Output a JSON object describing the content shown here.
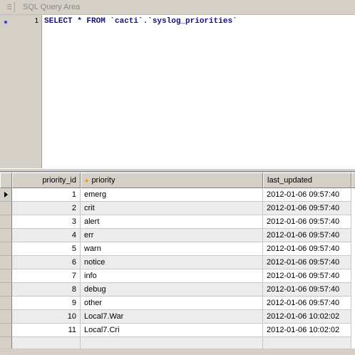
{
  "query_area": {
    "title": "SQL Query Area",
    "line_number": "1",
    "sql": "SELECT * FROM `cacti`.`syslog_priorities`"
  },
  "grid": {
    "columns": {
      "priority_id": "priority_id",
      "priority": "priority",
      "last_updated": "last_updated"
    },
    "rows": [
      {
        "priority_id": "1",
        "priority": "emerg",
        "last_updated": "2012-01-06 09:57:40"
      },
      {
        "priority_id": "2",
        "priority": "crit",
        "last_updated": "2012-01-06 09:57:40"
      },
      {
        "priority_id": "3",
        "priority": "alert",
        "last_updated": "2012-01-06 09:57:40"
      },
      {
        "priority_id": "4",
        "priority": "err",
        "last_updated": "2012-01-06 09:57:40"
      },
      {
        "priority_id": "5",
        "priority": "warn",
        "last_updated": "2012-01-06 09:57:40"
      },
      {
        "priority_id": "6",
        "priority": "notice",
        "last_updated": "2012-01-06 09:57:40"
      },
      {
        "priority_id": "7",
        "priority": "info",
        "last_updated": "2012-01-06 09:57:40"
      },
      {
        "priority_id": "8",
        "priority": "debug",
        "last_updated": "2012-01-06 09:57:40"
      },
      {
        "priority_id": "9",
        "priority": "other",
        "last_updated": "2012-01-06 09:57:40"
      },
      {
        "priority_id": "10",
        "priority": "Local7.War",
        "last_updated": "2012-01-06 10:02:02"
      },
      {
        "priority_id": "11",
        "priority": "Local7.Cri",
        "last_updated": "2012-01-06 10:02:02"
      }
    ]
  }
}
